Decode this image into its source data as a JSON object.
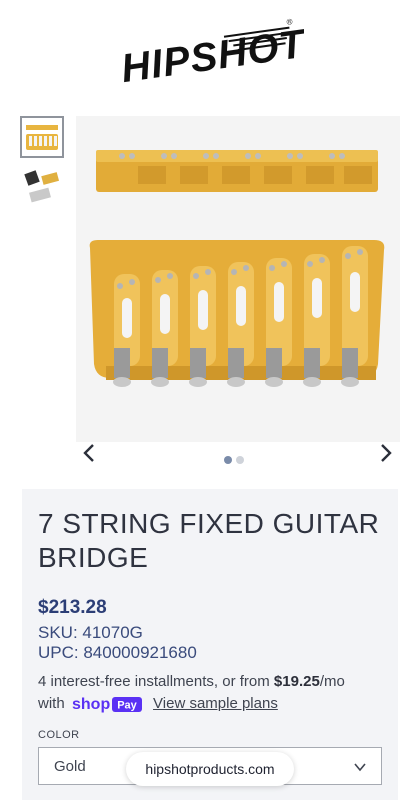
{
  "header": {
    "logo_text": "HIPSHOT",
    "logo_mark": "®"
  },
  "gallery": {
    "thumbnails": [
      "bridge-gold-thumb",
      "bridge-variants-thumb"
    ],
    "active_dot": 1,
    "dot_count": 2
  },
  "product": {
    "title": "7 STRING FIXED GUITAR BRIDGE",
    "price": "$213.28",
    "sku": "SKU: 41070G",
    "upc": "UPC: 840000921680",
    "installments_pre": "4 interest-free installments, or from ",
    "installments_amount": "$19.25",
    "installments_post": "/mo",
    "with_label": "with",
    "shop_pay_label": "shop",
    "shop_pay_badge": "Pay",
    "sample_plans_link": "View sample plans",
    "color_label": "COLOR",
    "color_value": "Gold"
  },
  "footer": {
    "domain_pill": "hipshotproducts.com"
  },
  "colors": {
    "gold": "#e8b53f",
    "accent": "#2c3e76",
    "shop_pay": "#5a31f4"
  }
}
